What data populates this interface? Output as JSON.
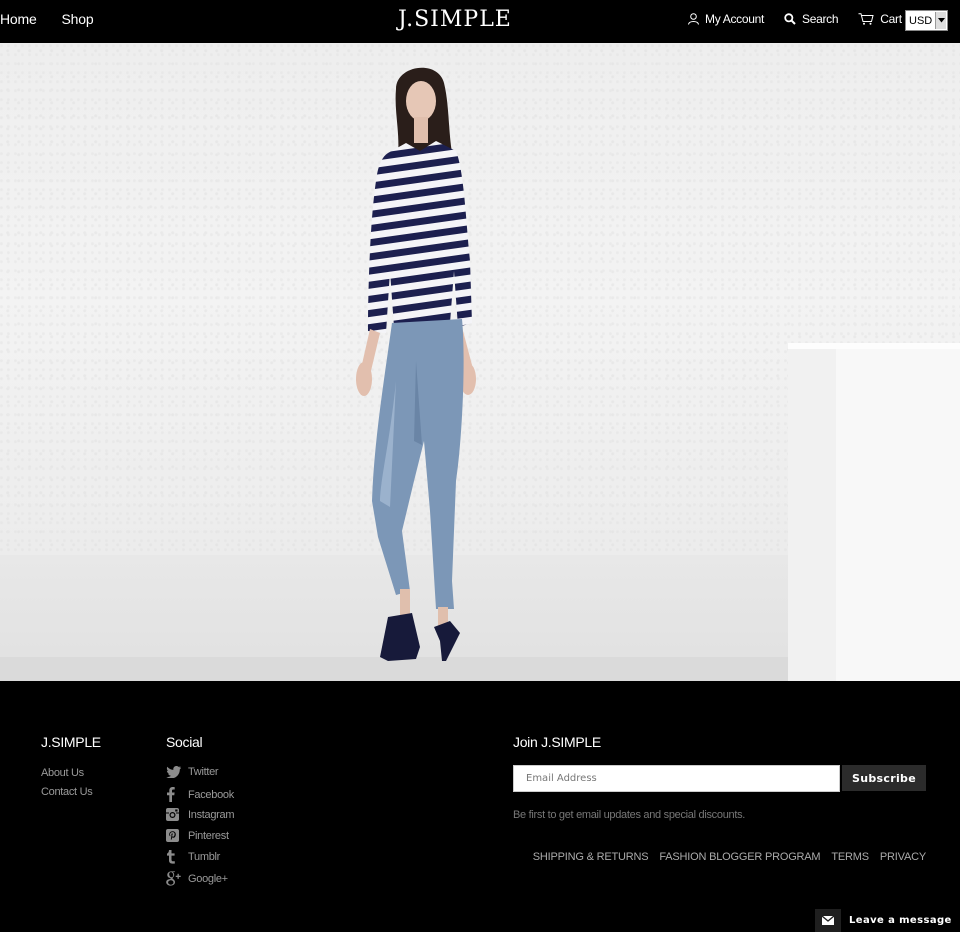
{
  "header": {
    "nav": [
      {
        "label": "Home"
      },
      {
        "label": "Shop"
      }
    ],
    "logo": "J.SIMPLE",
    "account_label": "My Account",
    "search_label": "Search",
    "cart_label": "Cart",
    "currency": "USD"
  },
  "hero": {
    "image": "model-in-striped-shirt-and-jeans"
  },
  "footer": {
    "brand": {
      "title": "J.SIMPLE",
      "links": [
        "About Us",
        "Contact Us"
      ]
    },
    "social": {
      "title": "Social",
      "items": [
        {
          "label": "Twitter",
          "icon": "twitter-icon"
        },
        {
          "label": "Facebook",
          "icon": "facebook-icon"
        },
        {
          "label": "Instagram",
          "icon": "instagram-icon"
        },
        {
          "label": "Pinterest",
          "icon": "pinterest-icon"
        },
        {
          "label": "Tumblr",
          "icon": "tumblr-icon"
        },
        {
          "label": "Google+",
          "icon": "google-plus-icon"
        }
      ]
    },
    "newsletter": {
      "title": "Join J.SIMPLE",
      "placeholder": "Email Address",
      "button": "Subscribe",
      "tagline": "Be first to get email updates and special discounts."
    },
    "policies": [
      "SHIPPING & RETURNS",
      "FASHION BLOGGER PROGRAM",
      "TERMS",
      "PRIVACY"
    ]
  },
  "chat": {
    "label": "Leave a message"
  }
}
